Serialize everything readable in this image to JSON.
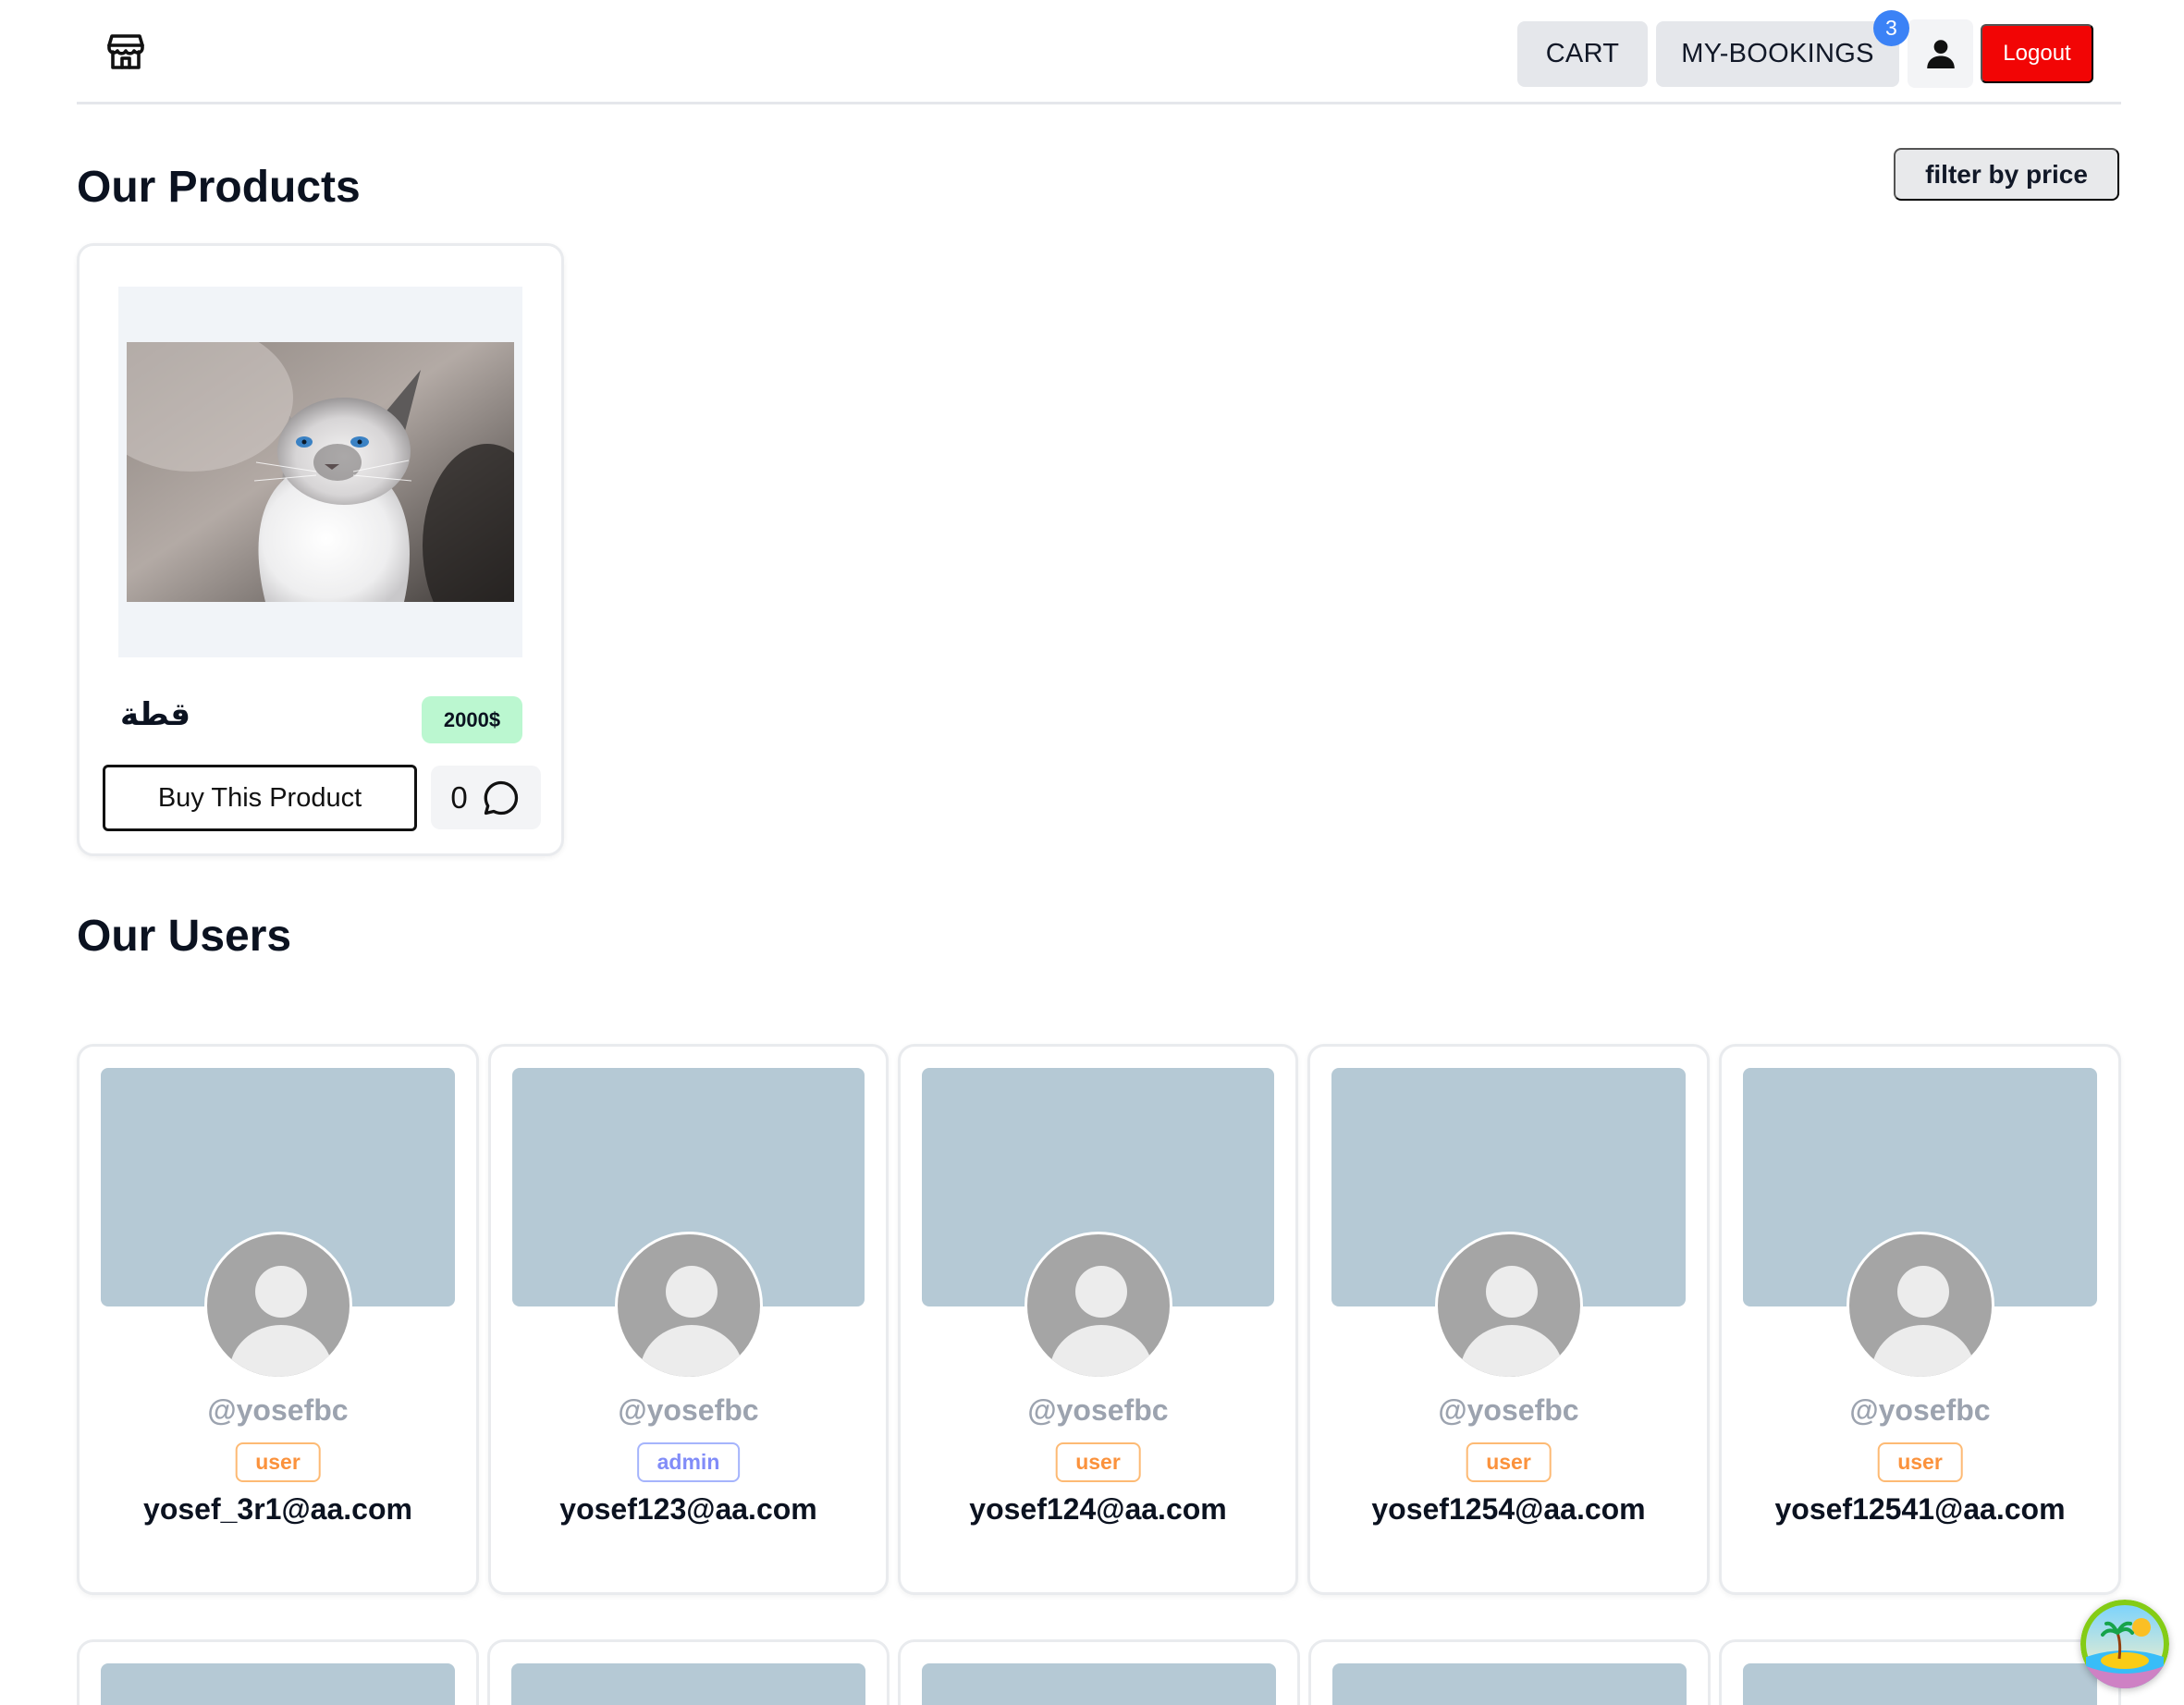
{
  "header": {
    "logo_icon": "store-icon",
    "cart_label": "CART",
    "bookings_label": "MY-BOOKINGS",
    "bookings_count": "3",
    "user_icon": "user-icon",
    "logout_label": "Logout"
  },
  "products_section": {
    "title": "Our Products",
    "filter_label": "filter by price",
    "products": [
      {
        "name": "قطة",
        "price": "2000$",
        "buy_label": "Buy This Product",
        "comment_count": "0",
        "comment_icon": "comment-icon"
      }
    ]
  },
  "users_section": {
    "title": "Our Users",
    "users": [
      {
        "username": "@yosefbc",
        "role": "user",
        "email": "yosef_3r1@aa.com"
      },
      {
        "username": "@yosefbc",
        "role": "admin",
        "email": "yosef123@aa.com"
      },
      {
        "username": "@yosefbc",
        "role": "user",
        "email": "yosef124@aa.com"
      },
      {
        "username": "@yosefbc",
        "role": "user",
        "email": "yosef1254@aa.com"
      },
      {
        "username": "@yosefbc",
        "role": "user",
        "email": "yosef12541@aa.com"
      }
    ]
  },
  "colors": {
    "logout": "#f20505",
    "badge": "#3b82f6",
    "price_badge": "#bbf7d0",
    "cover": "#b5c9d5",
    "role_user": "#fb923c",
    "role_admin": "#818cf8"
  }
}
